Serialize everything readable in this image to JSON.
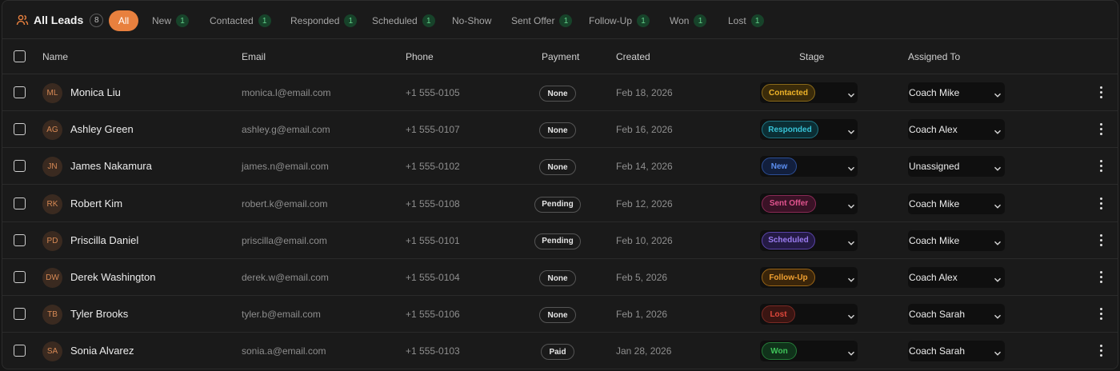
{
  "header": {
    "title": "All Leads",
    "count": "8"
  },
  "filters": [
    {
      "label": "All",
      "count": null,
      "active": true
    },
    {
      "label": "New",
      "count": "1",
      "active": false
    },
    {
      "label": "Contacted",
      "count": "1",
      "active": false
    },
    {
      "label": "Responded",
      "count": "1",
      "active": false
    },
    {
      "label": "Scheduled",
      "count": "1",
      "active": false
    },
    {
      "label": "No-Show",
      "count": null,
      "active": false
    },
    {
      "label": "Sent Offer",
      "count": "1",
      "active": false
    },
    {
      "label": "Follow-Up",
      "count": "1",
      "active": false
    },
    {
      "label": "Won",
      "count": "1",
      "active": false
    },
    {
      "label": "Lost",
      "count": "1",
      "active": false
    }
  ],
  "columns": {
    "name": "Name",
    "email": "Email",
    "phone": "Phone",
    "payment": "Payment",
    "created": "Created",
    "stage": "Stage",
    "assigned": "Assigned To"
  },
  "rows": [
    {
      "initials": "ML",
      "name": "Monica Liu",
      "email": "monica.l@email.com",
      "phone": "+1 555-0105",
      "payment": "None",
      "created": "Feb 18, 2026",
      "stage": "Contacted",
      "assigned": "Coach Mike"
    },
    {
      "initials": "AG",
      "name": "Ashley Green",
      "email": "ashley.g@email.com",
      "phone": "+1 555-0107",
      "payment": "None",
      "created": "Feb 16, 2026",
      "stage": "Responded",
      "assigned": "Coach Alex"
    },
    {
      "initials": "JN",
      "name": "James Nakamura",
      "email": "james.n@email.com",
      "phone": "+1 555-0102",
      "payment": "None",
      "created": "Feb 14, 2026",
      "stage": "New",
      "assigned": "Unassigned"
    },
    {
      "initials": "RK",
      "name": "Robert Kim",
      "email": "robert.k@email.com",
      "phone": "+1 555-0108",
      "payment": "Pending",
      "created": "Feb 12, 2026",
      "stage": "Sent Offer",
      "assigned": "Coach Mike"
    },
    {
      "initials": "PD",
      "name": "Priscilla Daniel",
      "email": "priscilla@email.com",
      "phone": "+1 555-0101",
      "payment": "Pending",
      "created": "Feb 10, 2026",
      "stage": "Scheduled",
      "assigned": "Coach Mike"
    },
    {
      "initials": "DW",
      "name": "Derek Washington",
      "email": "derek.w@email.com",
      "phone": "+1 555-0104",
      "payment": "None",
      "created": "Feb 5, 2026",
      "stage": "Follow-Up",
      "assigned": "Coach Alex"
    },
    {
      "initials": "TB",
      "name": "Tyler Brooks",
      "email": "tyler.b@email.com",
      "phone": "+1 555-0106",
      "payment": "None",
      "created": "Feb 1, 2026",
      "stage": "Lost",
      "assigned": "Coach Sarah"
    },
    {
      "initials": "SA",
      "name": "Sonia Alvarez",
      "email": "sonia.a@email.com",
      "phone": "+1 555-0103",
      "payment": "Paid",
      "created": "Jan 28, 2026",
      "stage": "Won",
      "assigned": "Coach Sarah"
    }
  ],
  "colors": {
    "accent": "#e8803e",
    "count_badge_bg": "#17432a",
    "count_badge_fg": "#63d08a",
    "stages": {
      "Contacted": {
        "fg": "#f0b429",
        "bg": "#3a2b0a",
        "border": "#8a6a1a"
      },
      "Responded": {
        "fg": "#38c3d6",
        "bg": "#0b2e34",
        "border": "#1f7685"
      },
      "New": {
        "fg": "#5b8ef0",
        "bg": "#121f3d",
        "border": "#2c4e96"
      },
      "Sent Offer": {
        "fg": "#e2548f",
        "bg": "#3a1226",
        "border": "#8a2a55"
      },
      "Scheduled": {
        "fg": "#9b7cf0",
        "bg": "#241a44",
        "border": "#5a44a8"
      },
      "Follow-Up": {
        "fg": "#f0a030",
        "bg": "#3a250a",
        "border": "#9a6516"
      },
      "Lost": {
        "fg": "#e0483c",
        "bg": "#3a1512",
        "border": "#7a2a24"
      },
      "Won": {
        "fg": "#3fc45a",
        "bg": "#10321a",
        "border": "#257a38"
      }
    }
  },
  "icons": {
    "leads": "users-icon",
    "row_menu": "more-vertical-icon",
    "select": "chevron-down-icon"
  }
}
